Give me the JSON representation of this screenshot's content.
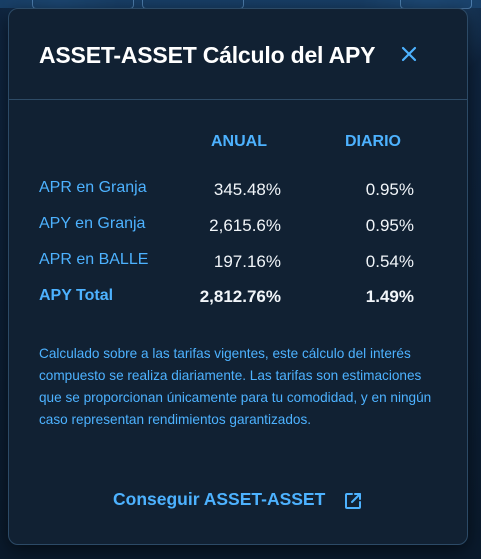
{
  "modal": {
    "title": "ASSET-ASSET Cálculo del APY",
    "close_icon": "close-icon",
    "columns": {
      "annual": "ANUAL",
      "daily": "DIARIO"
    },
    "rows": [
      {
        "label": "APR en Granja",
        "annual": "345.48%",
        "daily": "0.95%"
      },
      {
        "label": "APY en Granja",
        "annual": "2,615.6%",
        "daily": "0.95%"
      },
      {
        "label": "APR en BALLE",
        "annual": "197.16%",
        "daily": "0.54%"
      },
      {
        "label": "APY Total",
        "annual": "2,812.76%",
        "daily": "1.49%"
      }
    ],
    "note": "Calculado sobre a las tarifas vigentes, este cálculo del interés compuesto se realiza diariamente. Las tarifas son estimaciones que se proporcionan únicamente para tu comodidad, y en ningún caso representan rendimientos garantizados.",
    "link_label": "Conseguir ASSET-ASSET",
    "link_icon": "external-link-icon"
  },
  "colors": {
    "accent": "#4db2ff",
    "panel": "#112133",
    "text": "#f1f5f9"
  }
}
